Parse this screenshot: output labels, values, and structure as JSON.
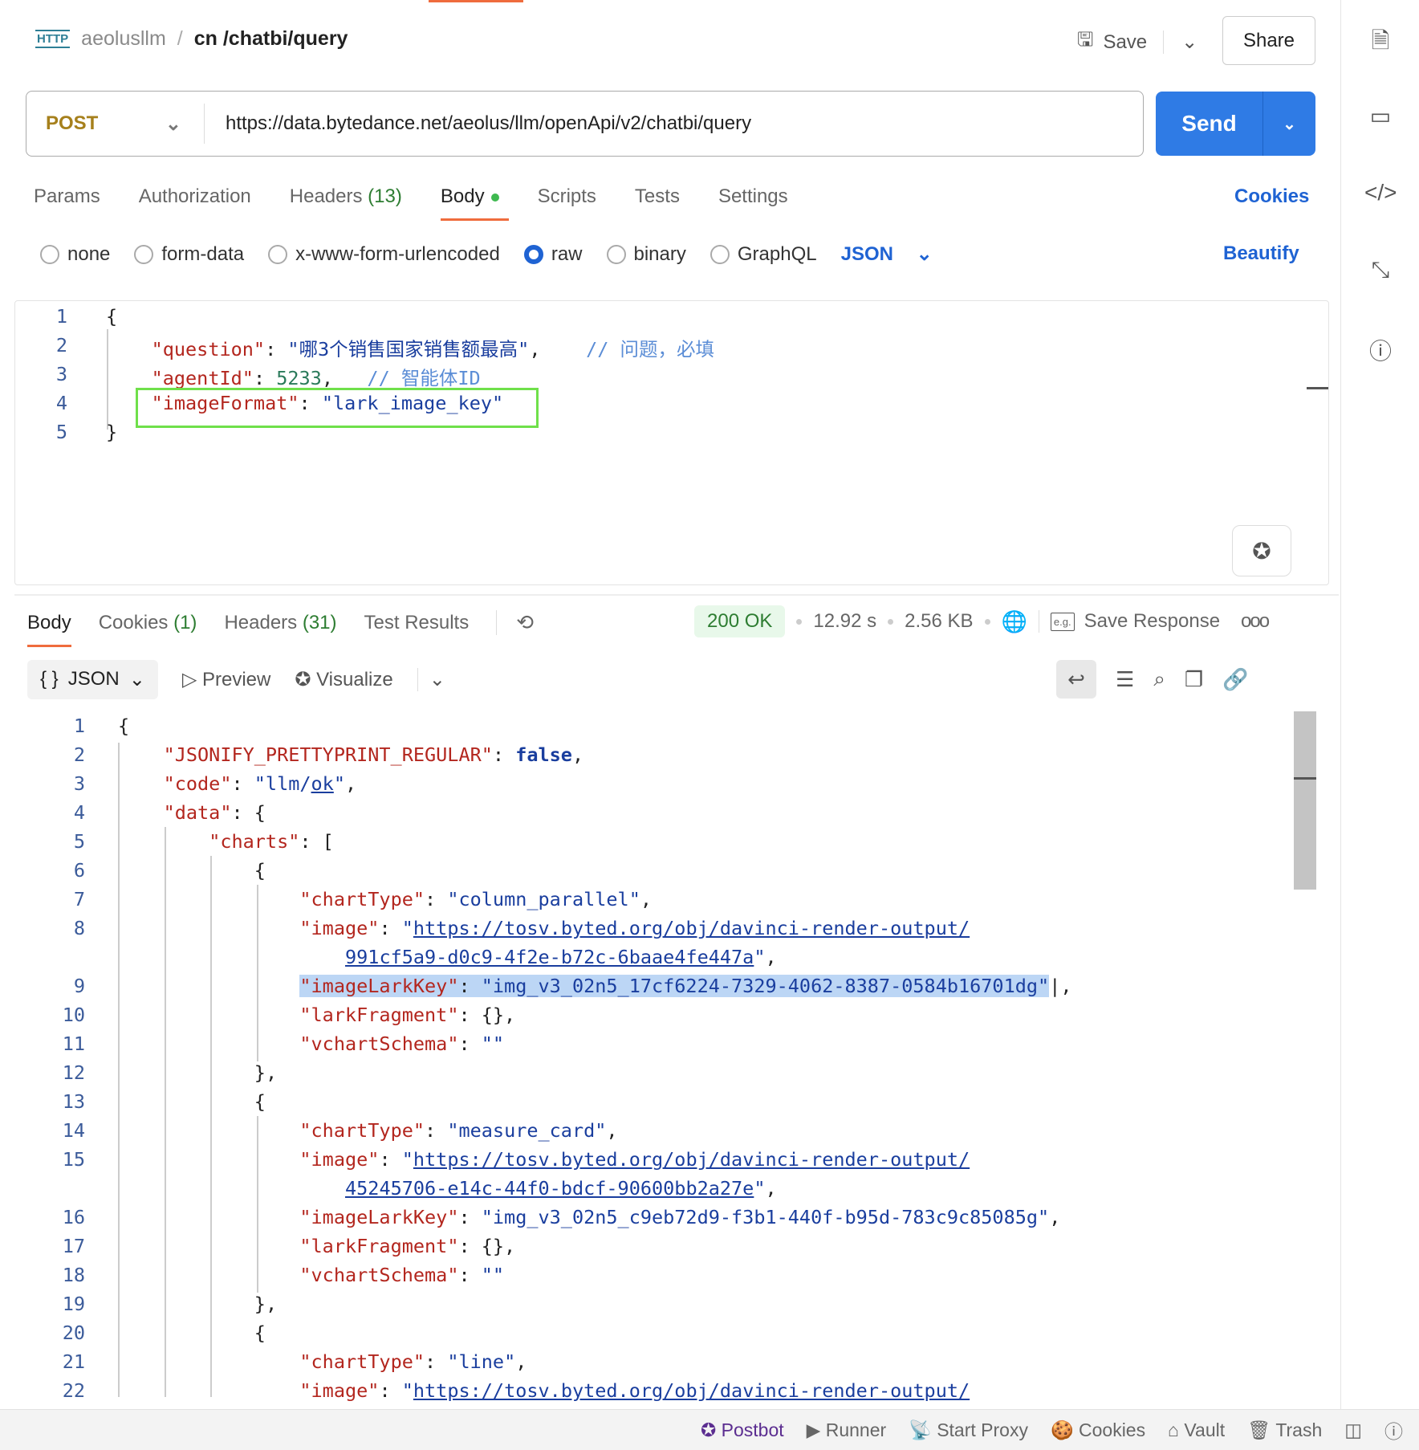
{
  "header": {
    "collection": "aeolusllm",
    "separator": "/",
    "request_name": "cn /chatbi/query",
    "http_badge": "HTTP",
    "save_label": "Save",
    "share_label": "Share"
  },
  "request": {
    "method": "POST",
    "url": "https://data.bytedance.net/aeolus/llm/openApi/v2/chatbi/query",
    "send_label": "Send"
  },
  "tabs": [
    {
      "label": "Params"
    },
    {
      "label": "Authorization"
    },
    {
      "label": "Headers",
      "count": "(13)"
    },
    {
      "label": "Body"
    },
    {
      "label": "Scripts"
    },
    {
      "label": "Tests"
    },
    {
      "label": "Settings"
    }
  ],
  "cookies_link": "Cookies",
  "body_types": [
    {
      "label": "none",
      "selected": false
    },
    {
      "label": "form-data",
      "selected": false
    },
    {
      "label": "x-www-form-urlencoded",
      "selected": false
    },
    {
      "label": "raw",
      "selected": true
    },
    {
      "label": "binary",
      "selected": false
    },
    {
      "label": "GraphQL",
      "selected": false
    }
  ],
  "raw_format": "JSON",
  "beautify_label": "Beautify",
  "request_body": [
    {
      "n": "1",
      "i": 0,
      "t": [
        [
          "p",
          "{"
        ]
      ]
    },
    {
      "n": "2",
      "i": 1,
      "t": [
        [
          "k",
          "\"question\""
        ],
        [
          "p",
          ": "
        ],
        [
          "s",
          "\"哪3个销售国家销售额最高\""
        ],
        [
          "p",
          ",    "
        ],
        [
          "cm",
          "// 问题，必填"
        ]
      ]
    },
    {
      "n": "3",
      "i": 1,
      "t": [
        [
          "k",
          "\"agentId\""
        ],
        [
          "p",
          ": "
        ],
        [
          "n",
          "5233"
        ],
        [
          "p",
          ",   "
        ],
        [
          "cm",
          "// 智能体ID"
        ]
      ]
    },
    {
      "n": "4",
      "i": 1,
      "t": [
        [
          "k",
          "\"imageFormat\""
        ],
        [
          "p",
          ": "
        ],
        [
          "s",
          "\"lark_image_key\""
        ]
      ]
    },
    {
      "n": "5",
      "i": 0,
      "t": [
        [
          "p",
          "}"
        ]
      ]
    }
  ],
  "response": {
    "tabs": [
      {
        "label": "Body"
      },
      {
        "label": "Cookies",
        "count": "(1)"
      },
      {
        "label": "Headers",
        "count": "(31)"
      },
      {
        "label": "Test Results"
      }
    ],
    "status": "200 OK",
    "time": "12.92 s",
    "size": "2.56 KB",
    "save_response": "Save Response",
    "eg": "e.g.",
    "format": "JSON",
    "preview": "Preview",
    "visualize": "Visualize",
    "lines": [
      {
        "n": "1",
        "i": 0,
        "t": [
          [
            "p",
            "{"
          ]
        ]
      },
      {
        "n": "2",
        "i": 1,
        "t": [
          [
            "k",
            "\"JSONIFY_PRETTYPRINT_REGULAR\""
          ],
          [
            "p",
            ": "
          ],
          [
            "b",
            "false"
          ],
          [
            "p",
            ","
          ]
        ]
      },
      {
        "n": "3",
        "i": 1,
        "t": [
          [
            "k",
            "\"code\""
          ],
          [
            "p",
            ": "
          ],
          [
            "s",
            "\"llm/"
          ],
          [
            "u",
            "ok"
          ],
          [
            "s",
            "\""
          ],
          [
            "p",
            ","
          ]
        ]
      },
      {
        "n": "4",
        "i": 1,
        "t": [
          [
            "k",
            "\"data\""
          ],
          [
            "p",
            ": {"
          ]
        ]
      },
      {
        "n": "5",
        "i": 2,
        "t": [
          [
            "k",
            "\"charts\""
          ],
          [
            "p",
            ": ["
          ]
        ]
      },
      {
        "n": "6",
        "i": 3,
        "t": [
          [
            "p",
            "{"
          ]
        ]
      },
      {
        "n": "7",
        "i": 4,
        "t": [
          [
            "k",
            "\"chartType\""
          ],
          [
            "p",
            ": "
          ],
          [
            "s",
            "\"column_parallel\""
          ],
          [
            "p",
            ","
          ]
        ]
      },
      {
        "n": "8",
        "i": 4,
        "t": [
          [
            "k",
            "\"image\""
          ],
          [
            "p",
            ": "
          ],
          [
            "s",
            "\""
          ],
          [
            "u",
            "https://tosv.byted.org/obj/davinci-render-output/"
          ]
        ]
      },
      {
        "n": "",
        "i": 5,
        "t": [
          [
            "u",
            "991cf5a9-d0c9-4f2e-b72c-6baae4fe447a"
          ],
          [
            "s",
            "\""
          ],
          [
            "p",
            ","
          ]
        ]
      },
      {
        "n": "9",
        "i": 4,
        "t": [
          [
            "k hl",
            "\"imageLarkKey\""
          ],
          [
            "p hl",
            ": "
          ],
          [
            "s hl",
            "\"img_v3_02n5_17cf6224-7329-4062-8387-0584b16701dg\""
          ],
          [
            "p",
            "|,"
          ]
        ]
      },
      {
        "n": "10",
        "i": 4,
        "t": [
          [
            "k",
            "\"larkFragment\""
          ],
          [
            "p",
            ": {},"
          ]
        ]
      },
      {
        "n": "11",
        "i": 4,
        "t": [
          [
            "k",
            "\"vchartSchema\""
          ],
          [
            "p",
            ": "
          ],
          [
            "s",
            "\"\""
          ]
        ]
      },
      {
        "n": "12",
        "i": 3,
        "t": [
          [
            "p",
            "},"
          ]
        ]
      },
      {
        "n": "13",
        "i": 3,
        "t": [
          [
            "p",
            "{"
          ]
        ]
      },
      {
        "n": "14",
        "i": 4,
        "t": [
          [
            "k",
            "\"chartType\""
          ],
          [
            "p",
            ": "
          ],
          [
            "s",
            "\"measure_card\""
          ],
          [
            "p",
            ","
          ]
        ]
      },
      {
        "n": "15",
        "i": 4,
        "t": [
          [
            "k",
            "\"image\""
          ],
          [
            "p",
            ": "
          ],
          [
            "s",
            "\""
          ],
          [
            "u",
            "https://tosv.byted.org/obj/davinci-render-output/"
          ]
        ]
      },
      {
        "n": "",
        "i": 5,
        "t": [
          [
            "u",
            "45245706-e14c-44f0-bdcf-90600bb2a27e"
          ],
          [
            "s",
            "\""
          ],
          [
            "p",
            ","
          ]
        ]
      },
      {
        "n": "16",
        "i": 4,
        "t": [
          [
            "k",
            "\"imageLarkKey\""
          ],
          [
            "p",
            ": "
          ],
          [
            "s",
            "\"img_v3_02n5_c9eb72d9-f3b1-440f-b95d-783c9c85085g\""
          ],
          [
            "p",
            ","
          ]
        ]
      },
      {
        "n": "17",
        "i": 4,
        "t": [
          [
            "k",
            "\"larkFragment\""
          ],
          [
            "p",
            ": {},"
          ]
        ]
      },
      {
        "n": "18",
        "i": 4,
        "t": [
          [
            "k",
            "\"vchartSchema\""
          ],
          [
            "p",
            ": "
          ],
          [
            "s",
            "\"\""
          ]
        ]
      },
      {
        "n": "19",
        "i": 3,
        "t": [
          [
            "p",
            "},"
          ]
        ]
      },
      {
        "n": "20",
        "i": 3,
        "t": [
          [
            "p",
            "{"
          ]
        ]
      },
      {
        "n": "21",
        "i": 4,
        "t": [
          [
            "k",
            "\"chartType\""
          ],
          [
            "p",
            ": "
          ],
          [
            "s",
            "\"line\""
          ],
          [
            "p",
            ","
          ]
        ]
      },
      {
        "n": "22",
        "i": 4,
        "t": [
          [
            "k",
            "\"image\""
          ],
          [
            "p",
            ": "
          ],
          [
            "s",
            "\""
          ],
          [
            "u",
            "https://tosv.byted.org/obj/davinci-render-output/"
          ]
        ]
      }
    ]
  },
  "footer": [
    {
      "label": "Postbot",
      "icon": "postbot-icon"
    },
    {
      "label": "Runner",
      "icon": "runner-icon"
    },
    {
      "label": "Start Proxy",
      "icon": "proxy-icon"
    },
    {
      "label": "Cookies",
      "icon": "cookie-icon"
    },
    {
      "label": "Vault",
      "icon": "vault-icon"
    },
    {
      "label": "Trash",
      "icon": "trash-icon"
    }
  ],
  "colors": {
    "accent": "#ef6c3d",
    "send": "#2f7be5",
    "status_ok": "#2e7d32",
    "highlight_box": "#6fe04a"
  }
}
